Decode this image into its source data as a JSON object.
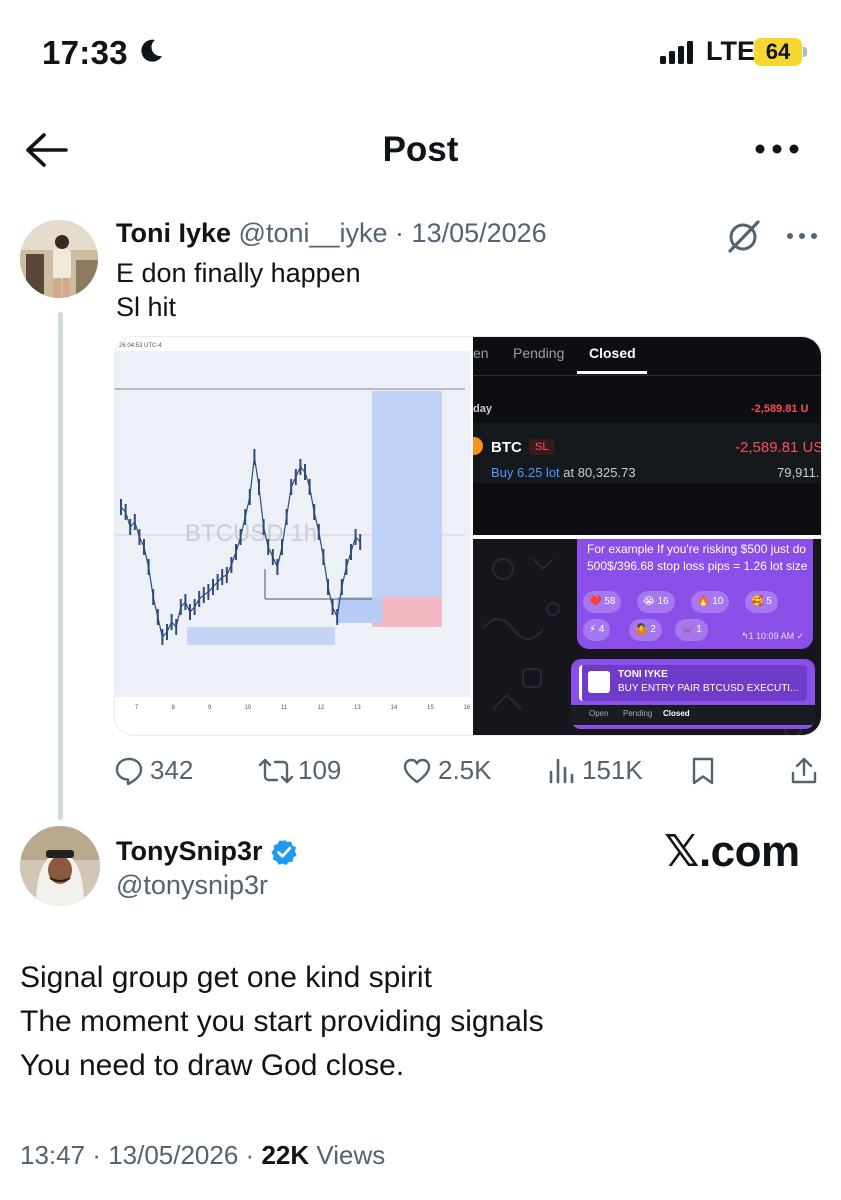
{
  "status_bar": {
    "time": "17:33",
    "network": "LTE",
    "battery": "64",
    "icons": [
      "moon-icon",
      "signal-icon"
    ]
  },
  "nav": {
    "title": "Post",
    "icons": [
      "arrow-left-icon",
      "more-horizontal-icon"
    ]
  },
  "quoted_post": {
    "author_name": "Toni Iyke",
    "handle": "@toni__iyke",
    "separator": " · ",
    "date": "13/05/2026",
    "text_line1": "E don finally happen",
    "text_line2": "Sl hit",
    "media": {
      "chart": {
        "header": "26 04:53 UTC-4",
        "watermark": "BTCUSD 1h",
        "x_labels": [
          "7",
          "8",
          "9",
          "10",
          "11",
          "12",
          "13",
          "14",
          "15",
          "16"
        ]
      },
      "trades": {
        "tabs": [
          "en",
          "Pending",
          "Closed"
        ],
        "active_tab": "Closed",
        "day_label": "day",
        "day_total": "-2,589.81 U",
        "symbol": "BTC",
        "badge": "SL",
        "pnl": "-2,589.81 US",
        "detail_lot": "Buy 6.25 lot",
        "detail_at": " at 80,325.73",
        "close_price": "79,911."
      },
      "chat": {
        "message": "For example If you're risking $500 just do 500$/396.68 stop loss pips = 1.26 lot size",
        "reactions": [
          {
            "emoji": "❤️",
            "count": "58"
          },
          {
            "emoji": "😭",
            "count": "16"
          },
          {
            "emoji": "🔥",
            "count": "10"
          },
          {
            "emoji": "🥰",
            "count": "5"
          },
          {
            "emoji": "⚡",
            "count": "4"
          },
          {
            "emoji": "🤷",
            "count": "2"
          },
          {
            "emoji": "👾",
            "count": "1"
          }
        ],
        "time": "↰1  10:09 AM ✓",
        "reply_name": "TONI IYKE",
        "reply_sub": "BUY ENTRY PAIR BTCUSD EXECUTI...",
        "reply_tabs": [
          "Open",
          "Pending",
          "Closed"
        ]
      }
    },
    "stats": {
      "replies": "342",
      "reposts": "109",
      "likes": "2.5K",
      "views": "151K"
    }
  },
  "main_post": {
    "author_name": "TonySnip3r",
    "handle": "@tonysnip3r",
    "watermark": "𝕏.com",
    "text_line1": "Signal group get one kind spirit",
    "text_line2": "The moment you start providing signals",
    "text_line3": "You need to draw God close.",
    "time": "13:47",
    "separator1": " · ",
    "date": "13/05/2026",
    "separator2": " · ",
    "views_count": "22K",
    "views_label": " Views"
  },
  "colors": {
    "text": "#0f1419",
    "muted": "#536471",
    "verified": "#1d9bf0",
    "battery": "#f8d630",
    "loss": "#ff4d4f",
    "chat_bubble": "#8a4fe8"
  }
}
